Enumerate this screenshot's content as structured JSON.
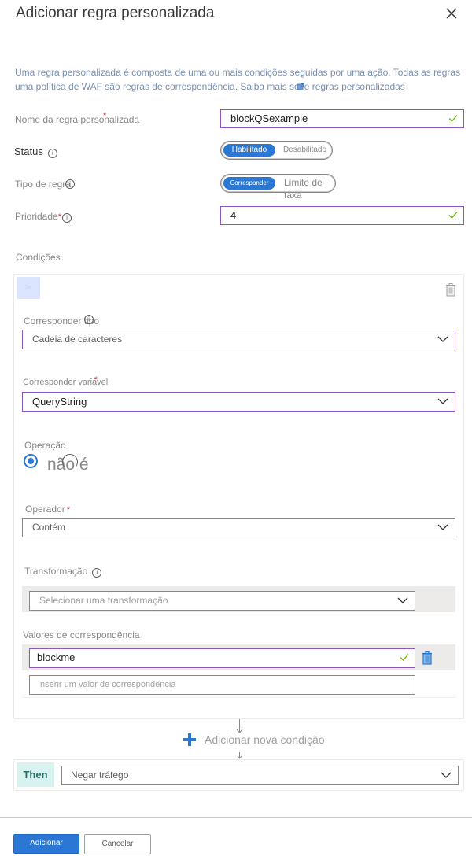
{
  "header": {
    "title": "Adicionar regra personalizada",
    "close_icon": "close-icon"
  },
  "description": {
    "line1": "Uma regra personalizada é composta de uma ou mais condições seguidas por uma ação. Todas as regras",
    "line2_prefix": "uma política de WAF são regras de correspondência. Saiba mais so",
    "line2_link_suffix": "re regras personalizadas",
    "link_icon": "external-link-icon"
  },
  "form": {
    "rule_name": {
      "label": "Nome da regra personalizada",
      "required_mark": "*",
      "value": "blockQSexample",
      "valid": true
    },
    "status": {
      "label": "Status",
      "options": [
        "Habilitado",
        "Desabilitado"
      ],
      "selected": "Habilitado"
    },
    "rule_type": {
      "label": "Tipo de regra",
      "options": [
        "Corresponder",
        "Limite de taxa"
      ],
      "selected": "Corresponder"
    },
    "priority": {
      "label": "Prioridade",
      "required_mark": "*",
      "value": "4",
      "valid": true
    }
  },
  "conditions": {
    "section_label": "Condições",
    "badge": "Se",
    "match_type": {
      "label": "Corresponder tipo",
      "value": "Cadeia de caracteres"
    },
    "match_variable": {
      "label": "Corresponder variável",
      "required_mark": "*",
      "value": "QueryString"
    },
    "operation": {
      "label": "Operação",
      "option_label": "não é",
      "selected": true
    },
    "operator": {
      "label": "Operador",
      "required_mark": "*",
      "value": "Contém"
    },
    "transformation": {
      "label": "Transformação",
      "placeholder": "Selecionar uma transformação"
    },
    "match_values": {
      "label": "Valores de correspondência",
      "values": [
        "blockme"
      ],
      "placeholder": "Inserir um valor de correspondência"
    },
    "add_condition_label": "Adicionar nova condição"
  },
  "then": {
    "badge": "Then",
    "action": "Negar tráfego"
  },
  "footer": {
    "add_label": "Adicionar",
    "cancel_label": "Cancelar"
  },
  "colors": {
    "accent": "#2b78d4",
    "focus_border": "#8a57c0",
    "valid_check": "#6bb700",
    "then_badge_bg": "#d7f2ef"
  }
}
